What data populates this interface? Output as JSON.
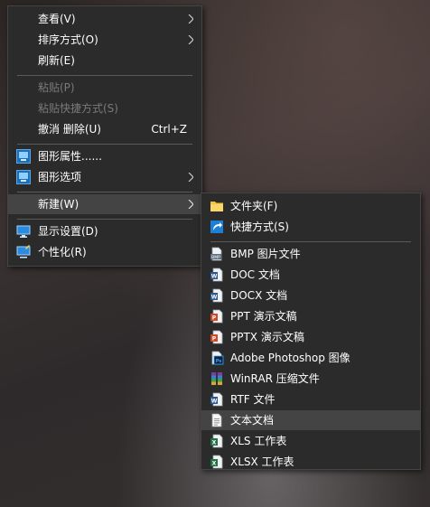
{
  "main_menu": {
    "items": [
      {
        "label": "查看(V)"
      },
      {
        "label": "排序方式(O)"
      },
      {
        "label": "刷新(E)"
      },
      {
        "label": "粘贴(P)"
      },
      {
        "label": "粘贴快捷方式(S)"
      },
      {
        "label": "撤消 删除(U)",
        "accel": "Ctrl+Z"
      },
      {
        "label": "图形属性......",
        "icon": "graphics-properties-icon"
      },
      {
        "label": "图形选项",
        "icon": "graphics-options-icon"
      },
      {
        "label": "新建(W)"
      },
      {
        "label": "显示设置(D)",
        "icon": "display-settings-icon"
      },
      {
        "label": "个性化(R)",
        "icon": "personalize-icon"
      }
    ]
  },
  "sub_menu": {
    "items": [
      {
        "label": "文件夹(F)",
        "icon": "folder-icon"
      },
      {
        "label": "快捷方式(S)",
        "icon": "shortcut-icon"
      },
      {
        "label": "BMP 图片文件",
        "icon": "bmp-file-icon"
      },
      {
        "label": "DOC 文档",
        "icon": "doc-file-icon"
      },
      {
        "label": "DOCX 文档",
        "icon": "docx-file-icon"
      },
      {
        "label": "PPT 演示文稿",
        "icon": "ppt-file-icon"
      },
      {
        "label": "PPTX 演示文稿",
        "icon": "pptx-file-icon"
      },
      {
        "label": "Adobe Photoshop 图像",
        "icon": "photoshop-file-icon"
      },
      {
        "label": "WinRAR 压缩文件",
        "icon": "winrar-file-icon"
      },
      {
        "label": "RTF 文件",
        "icon": "rtf-file-icon"
      },
      {
        "label": "文本文档",
        "icon": "text-document-icon"
      },
      {
        "label": "XLS 工作表",
        "icon": "xls-file-icon"
      },
      {
        "label": "XLSX 工作表",
        "icon": "xlsx-file-icon"
      }
    ]
  },
  "colors": {
    "menu_bg": "#2b2b2b",
    "highlight": "#444444",
    "text": "#ffffff",
    "disabled_text": "#7a7a7a",
    "word_blue": "#2b5797",
    "ppt_orange": "#d24726",
    "excel_green": "#217346",
    "folder_yellow": "#f3c440"
  }
}
